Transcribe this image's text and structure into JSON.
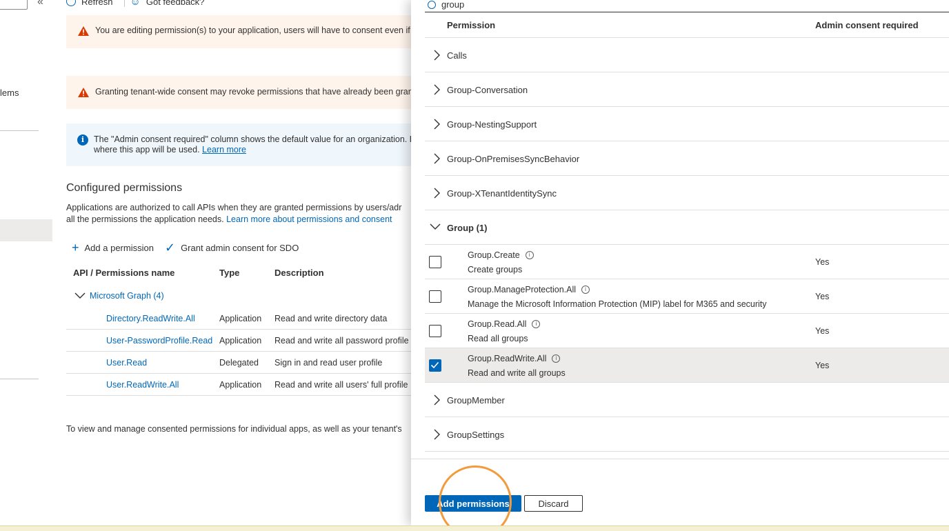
{
  "toolbar": {
    "refresh_label": "Refresh",
    "feedback_label": "Got feedback?"
  },
  "leftnav": {
    "partial_item": "lems"
  },
  "banners": {
    "editing_warning": "You are editing permission(s) to your application, users will have to consent even if they",
    "consent_warning": "Granting tenant-wide consent may revoke permissions that have already been granted",
    "info_line1": "The \"Admin consent required\" column shows the default value for an organization. How",
    "info_line2": "where this app will be used.",
    "info_link": "Learn more"
  },
  "configured": {
    "title": "Configured permissions",
    "desc_line1": "Applications are authorized to call APIs when they are granted permissions by users/adr",
    "desc_line2": "all the permissions the application needs.",
    "desc_link": "Learn more about permissions and consent",
    "add_permission": "Add a permission",
    "grant_consent": "Grant admin consent for SDO",
    "headers": {
      "name": "API / Permissions name",
      "type": "Type",
      "description": "Description"
    },
    "group_label": "Microsoft Graph (4)",
    "rows": [
      {
        "name": "Directory.ReadWrite.All",
        "type": "Application",
        "description": "Read and write directory data"
      },
      {
        "name": "User-PasswordProfile.ReadWr",
        "type": "Application",
        "description": "Read and write all password profile"
      },
      {
        "name": "User.Read",
        "type": "Delegated",
        "description": "Sign in and read user profile"
      },
      {
        "name": "User.ReadWrite.All",
        "type": "Application",
        "description": "Read and write all users' full profile"
      }
    ],
    "footer_note": "To view and manage consented permissions for individual apps, as well as your tenant's"
  },
  "panel": {
    "search_value": "group",
    "headers": {
      "permission": "Permission",
      "admin_consent": "Admin consent required"
    },
    "groups_top": [
      {
        "label": "Calls"
      },
      {
        "label": "Group-Conversation"
      },
      {
        "label": "Group-NestingSupport"
      },
      {
        "label": "Group-OnPremisesSyncBehavior"
      },
      {
        "label": "Group-XTenantIdentitySync"
      }
    ],
    "open_group": {
      "label": "Group (1)"
    },
    "permissions": [
      {
        "name": "Group.Create",
        "description": "Create groups",
        "admin": "Yes",
        "checked": false
      },
      {
        "name": "Group.ManageProtection.All",
        "description": "Manage the Microsoft Information Protection (MIP) label for M365 and security",
        "admin": "Yes",
        "checked": false
      },
      {
        "name": "Group.Read.All",
        "description": "Read all groups",
        "admin": "Yes",
        "checked": false
      },
      {
        "name": "Group.ReadWrite.All",
        "description": "Read and write all groups",
        "admin": "Yes",
        "checked": true
      }
    ],
    "groups_bottom": [
      {
        "label": "GroupMember"
      },
      {
        "label": "GroupSettings"
      }
    ],
    "add_button": "Add permissions",
    "discard_button": "Discard"
  },
  "colors": {
    "accent": "#0067b8",
    "warning_bg": "#fff4ec",
    "info_bg": "#eff6fc",
    "highlight": "#f39a3c"
  },
  "icons": {
    "info_glyph": "i",
    "small_info_glyph": "i"
  }
}
